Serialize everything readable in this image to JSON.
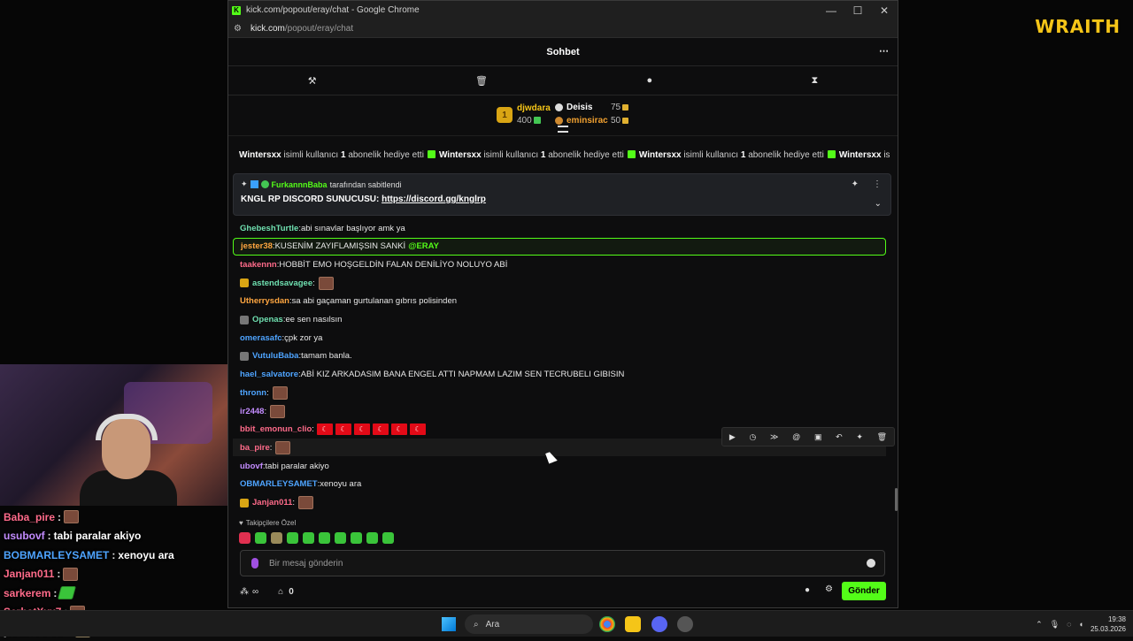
{
  "overlay": {
    "brand": "WRAITH",
    "chat": [
      {
        "user": "Baba_pire",
        "color": "#ff6b8a",
        "text": "",
        "emote": true
      },
      {
        "user": "usubovf",
        "color": "#c38cff",
        "text": "tabi paralar akiyo"
      },
      {
        "user": "BOBMARLEYSAMET",
        "color": "#4ea4ff",
        "text": "xenoyu ara"
      },
      {
        "user": "Janjan011",
        "color": "#ff6b8a",
        "text": "",
        "emote": true
      },
      {
        "user": "sarkerem",
        "color": "#ff6b8a",
        "text": "",
        "emote_green": true
      },
      {
        "user": "SerhatXxx7",
        "color": "#ff6b8a",
        "text": "",
        "emote": true
      },
      {
        "user": "yeniironman",
        "color": "#ffffff",
        "text": "",
        "emote_figure": true
      }
    ]
  },
  "window": {
    "title": "kick.com/popout/eray/chat - Google Chrome",
    "url_host": "kick.com",
    "url_path": "/popout/eray/chat",
    "controls": {
      "minimize": "—",
      "maximize": "☐",
      "close": "✕"
    }
  },
  "chat": {
    "header_title": "Sohbet",
    "menu_icon": "⋯",
    "tools": {
      "hammer": "⚒",
      "trash": "🗑",
      "chat": "●",
      "hourglass": "⧗"
    },
    "leaderboard": {
      "first": {
        "rank": "1",
        "name": "djwdara",
        "amount": "400"
      },
      "second": {
        "name": "Deisis",
        "amount": "75"
      },
      "third": {
        "name": "eminsirac",
        "amount": "50"
      }
    },
    "gift_ticker": [
      {
        "user": "Wintersxx",
        "pre": "isimli kullanıcı",
        "count": "1",
        "post": "abonelik hediye etti"
      },
      {
        "user": "Wintersxx",
        "pre": "isimli kullanıcı",
        "count": "1",
        "post": "abonelik hediye etti"
      },
      {
        "user": "Wintersxx",
        "pre": "isimli kullanıcı",
        "count": "1",
        "post": "abonelik hediye etti"
      },
      {
        "user": "Wintersxx",
        "pre": "isimli kullanıcı",
        "count": "1",
        "post": "abonelik hediye etti"
      }
    ],
    "pinned": {
      "by_user": "FurkannnBaba",
      "by_text": "tarafından sabitlendi",
      "message": "KNGL RP DISCORD SUNUCUSU:",
      "link": "https://discord.gg/knglrp"
    },
    "messages": [
      {
        "user": "GhebeshTurtle",
        "color": "#6fe0b0",
        "text": "abi sınavlar başlıyor amk ya"
      },
      {
        "user": "jester38",
        "color": "#ffa640",
        "text": "KUSENİM ZAYIFLAMIŞSIN SANKİ",
        "mention": "@ERAY",
        "highlight": true
      },
      {
        "user": "taakennn",
        "color": "#ff6b8a",
        "text": "HOBBİT EMO HOŞGELDİN FALAN DENİLİYO NOLUYO ABİ"
      },
      {
        "user": "astendsavagee",
        "color": "#6fe0b0",
        "text": "",
        "badge": "gold",
        "emote": true
      },
      {
        "user": "Utherrysdan",
        "color": "#ffa640",
        "text": "sa abi gaçaman gurtulanan gıbrıs polisinden"
      },
      {
        "user": "Openas",
        "color": "#6fe0b0",
        "text": "ee sen nasılsın",
        "badge": "grey"
      },
      {
        "user": "omerasafc",
        "color": "#4ea4ff",
        "text": "çpk zor ya"
      },
      {
        "user": "VutuluBaba",
        "color": "#4ea4ff",
        "text": "tamam banla.",
        "badge": "grey"
      },
      {
        "user": "hael_salvatore",
        "color": "#4ea4ff",
        "text": "ABİ KIZ ARKADASIM BANA ENGEL ATTI NAPMAM LAZIM SEN TECRUBELI GIBISIN"
      },
      {
        "user": "thronn",
        "color": "#4ea4ff",
        "text": "",
        "emote": true
      },
      {
        "user": "ir2448",
        "color": "#c38cff",
        "text": "",
        "emote": true
      },
      {
        "user": "bbit_emonun_clio",
        "color": "#ff6b8a",
        "text": "",
        "flags": [
          "☾",
          "☾",
          "☾",
          "☾",
          "☾",
          "☾"
        ]
      },
      {
        "user": "ba_pire",
        "color": "#ff6b8a",
        "text": "",
        "emote": true,
        "hover": true
      },
      {
        "user": "ubovf",
        "color": "#c38cff",
        "text": "tabi paralar akiyo"
      },
      {
        "user": "OBMARLEYSAMET",
        "color": "#4ea4ff",
        "text": "xenoyu ara"
      },
      {
        "user": "Janjan011",
        "color": "#ff6b8a",
        "text": "",
        "badge": "gold",
        "emote": true
      }
    ],
    "action_icons": [
      "▶",
      "◷",
      "≫",
      "@",
      "▣",
      "↶",
      "✦",
      "🗑"
    ],
    "followers_label": "Takipçilere Özel",
    "input_placeholder": "Bir mesaj gönderin",
    "footer": {
      "infinity": "∞",
      "count": "0",
      "send_label": "Gönder"
    }
  },
  "taskbar": {
    "search_label": "Ara",
    "time": "19:38",
    "date": "25.03.2026"
  },
  "colors": {
    "kick_green": "#53fc18",
    "gold": "#d9a514"
  }
}
